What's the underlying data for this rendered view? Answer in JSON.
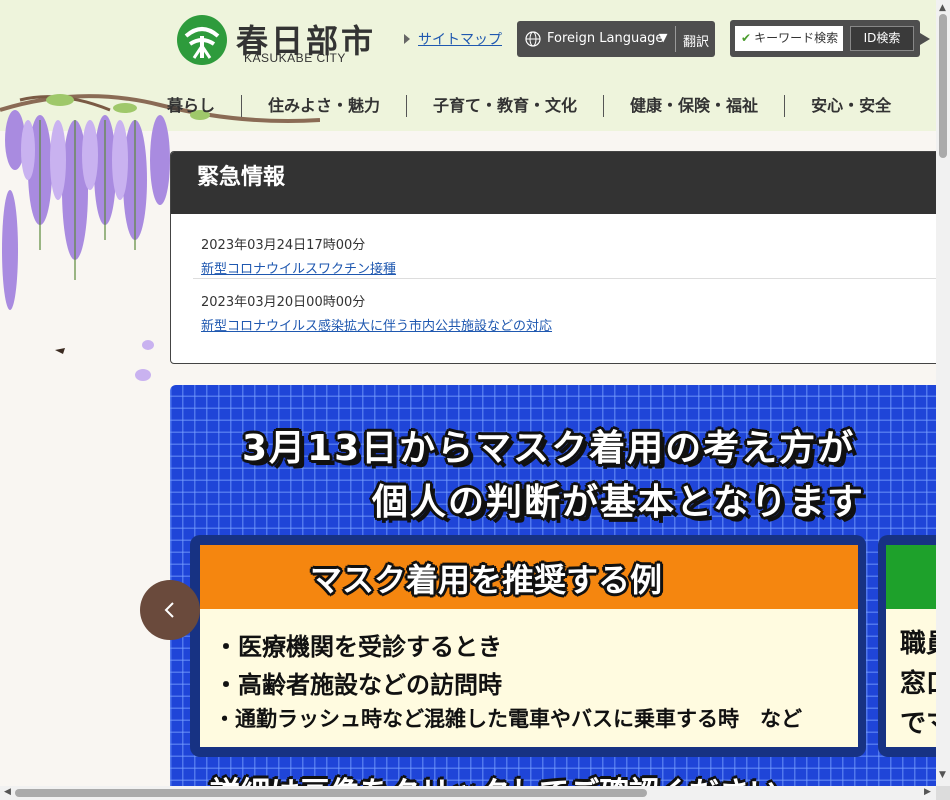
{
  "header": {
    "logo_ja": "春日部市",
    "logo_en": "KASUKABE CITY",
    "sitemap_label": "サイトマップ",
    "language_label": "Foreign Language",
    "language_caret": "▼",
    "translate_label": "翻訳",
    "keyword_search_label": "キーワード検索",
    "id_search_label": "ID検索"
  },
  "global_nav": {
    "items": [
      {
        "label": "暮らし"
      },
      {
        "label": "住みよさ・魅力"
      },
      {
        "label": "子育て・教育・文化"
      },
      {
        "label": "健康・保険・福祉"
      },
      {
        "label": "安心・安全"
      }
    ]
  },
  "emergency": {
    "title": "緊急情報",
    "items": [
      {
        "date": "2023年03月24日17時00分",
        "link": "新型コロナウイルスワクチン接種"
      },
      {
        "date": "2023年03月20日00時00分",
        "link": "新型コロナウイルス感染拡大に伴う市内公共施設などの対応"
      }
    ]
  },
  "banner": {
    "line1": "3月13日からマスク着用の考え方が",
    "line2": "個人の判断が基本となります",
    "card_title": "マスク着用を推奨する例",
    "card_items": [
      "・医療機関を受診するとき",
      "・高齢者施設などの訪問時",
      "・通勤ラッシュ時など混雑した電車やバスに乗車する時　など"
    ],
    "card2_lines": [
      "職員",
      "窓口",
      "でマ"
    ],
    "bottom_line": "詳細は画像をクリックしてご確認ください"
  },
  "colors": {
    "header_bg": "#eef4dc",
    "emergency_head": "#333333",
    "link": "#1f58b0",
    "banner_blue": "#1f45d8",
    "card_orange": "#f5860f",
    "card2_green": "#1ea12b",
    "prev_button": "#6a4a3c"
  },
  "icons": {
    "logo": "kasukabe-city-emblem",
    "globe": "globe-icon",
    "check": "check-icon",
    "prev": "chevron-left-icon"
  }
}
